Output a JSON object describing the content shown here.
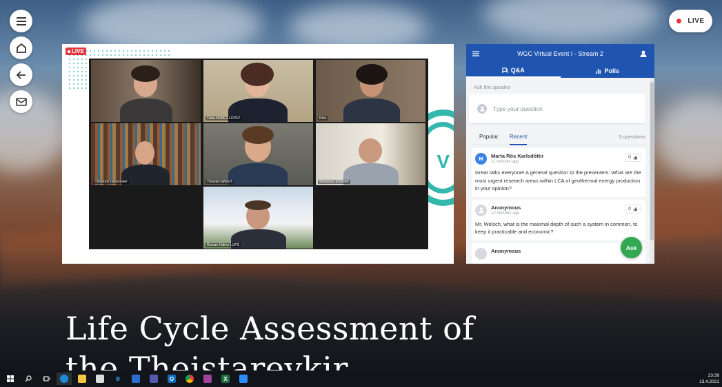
{
  "top_right": {
    "live_label": "LIVE"
  },
  "slide": {
    "live_badge": "LIVE",
    "participants": [
      {
        "name": ""
      },
      {
        "name": "Carla NUNEZ LOPEZ"
      },
      {
        "name": "Kiha"
      },
      {
        "name": "Christoph Ostermaier"
      },
      {
        "name": "Thorsten Welsch"
      },
      {
        "name": "Mohamed ElSheikh"
      },
      {
        "name": "Roman Hafner LUPS"
      }
    ]
  },
  "panel": {
    "title": "WGC Virtual Event I - Stream 2",
    "tabs": [
      "Q&A",
      "Polls"
    ],
    "ask_speaker_label": "Ask the speaker",
    "question_placeholder": "Type your question",
    "sort_options": [
      "Popular",
      "Recent"
    ],
    "question_count": "5 questions",
    "questions": [
      {
        "initial": "M",
        "author": "Marta Rós Karlsdóttir",
        "time": "11 minutes ago",
        "likes": "0",
        "text": "Great talks everyone! A general question to the presenters: What are the most urgent research areas within LCA of geothermal energy production in your opinion?"
      },
      {
        "initial": "",
        "author": "Anonymous",
        "time": "12 minutes ago",
        "likes": "0",
        "text": "Mr. Welsch, what is the maximal depth of such a system in common, to keep it practicable and economic?"
      },
      {
        "initial": "",
        "author": "Anonymous",
        "time": "",
        "likes": "",
        "text": ""
      }
    ],
    "ask_button": "Ask"
  },
  "session_title": "Life Cycle Assessment of the Theistareykir",
  "taskbar": {
    "time": "23:39",
    "date": "13.4.2021"
  }
}
